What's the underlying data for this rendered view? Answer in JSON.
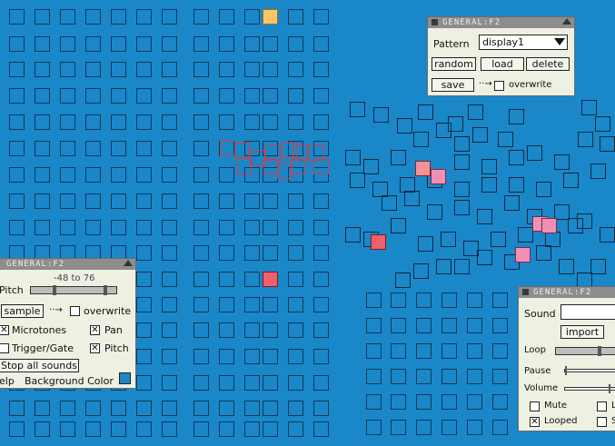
{
  "colors": {
    "background": "#1a87c9",
    "grid_cell": "#0d3a5a",
    "yellow": "#f9c76a",
    "red": "#f0606a",
    "pink": "#f28fb5"
  },
  "panel_pattern": {
    "title": "GENERAL:F2",
    "pattern_label": "Pattern",
    "pattern_value": "display1",
    "random_label": "random",
    "load_label": "load",
    "delete_label": "delete",
    "save_label": "save",
    "arrow": "··→",
    "overwrite_label": "overwrite"
  },
  "panel_pitch": {
    "title": "GENERAL:F2",
    "pitch_range": "-48 to 76",
    "pitch_label": "Pitch",
    "sample_label": "sample",
    "arrow": "··→",
    "overwrite_label": "overwrite",
    "microtones_label": "Microtones",
    "pan_label": "Pan",
    "trigger_gate_label": "Trigger/Gate",
    "pitch_check_label": "Pitch",
    "stop_all_label": "Stop all sounds",
    "help_label": "elp",
    "background_color_label": "Background Color",
    "checks": {
      "overwrite": false,
      "microtones": true,
      "pan": true,
      "trigger_gate": false,
      "pitch": true
    }
  },
  "panel_sound": {
    "title": "GENERAL:F2",
    "sound_label": "Sound",
    "import_label": "import",
    "loop_label": "Loop",
    "pause_label": "Pause",
    "volume_label": "Volume",
    "mute_label": "Mute",
    "looped_label": "Looped",
    "l_partial": "L",
    "s_partial": "S",
    "checks": {
      "mute": false,
      "looped": true
    }
  }
}
